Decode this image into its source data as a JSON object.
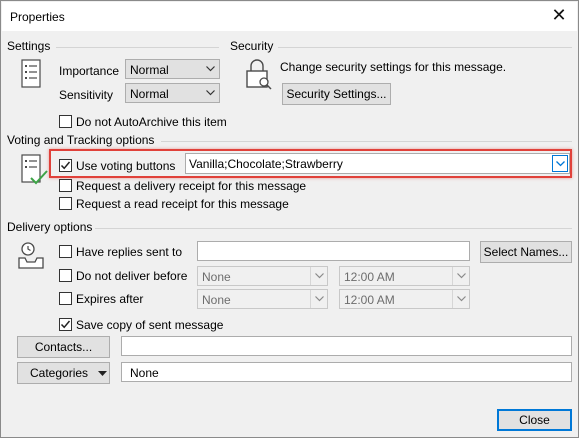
{
  "window": {
    "title": "Properties",
    "close_glyph": "✕"
  },
  "settings": {
    "group_label": "Settings",
    "importance_label": "Importance",
    "importance_value": "Normal",
    "sensitivity_label": "Sensitivity",
    "sensitivity_value": "Normal",
    "autoarchive_label": "Do not AutoArchive this item",
    "autoarchive_checked": false
  },
  "security": {
    "group_label": "Security",
    "description": "Change security settings for this message.",
    "button_label": "Security Settings..."
  },
  "voting": {
    "group_label": "Voting and Tracking options",
    "use_voting_label": "Use voting buttons",
    "use_voting_checked": true,
    "voting_value": "Vanilla;Chocolate;Strawberry",
    "delivery_receipt_label": "Request a delivery receipt for this message",
    "read_receipt_label": "Request a read receipt for this message",
    "highlight_color": "#e0413a"
  },
  "delivery": {
    "group_label": "Delivery options",
    "replies_label": "Have replies sent to",
    "replies_value": "",
    "select_names_label": "Select Names...",
    "do_not_deliver_label": "Do not deliver before",
    "do_not_deliver_date": "None",
    "do_not_deliver_time": "12:00 AM",
    "expires_label": "Expires after",
    "expires_date": "None",
    "expires_time": "12:00 AM",
    "save_copy_label": "Save copy of sent message",
    "save_copy_checked": true
  },
  "contacts": {
    "button_label": "Contacts...",
    "value": ""
  },
  "categories": {
    "button_label": "Categories",
    "value": "None"
  },
  "footer": {
    "close_label": "Close"
  },
  "colors": {
    "accent": "#0078d7",
    "dialog_bg": "#f0f0f0",
    "check_green": "#3da447"
  }
}
